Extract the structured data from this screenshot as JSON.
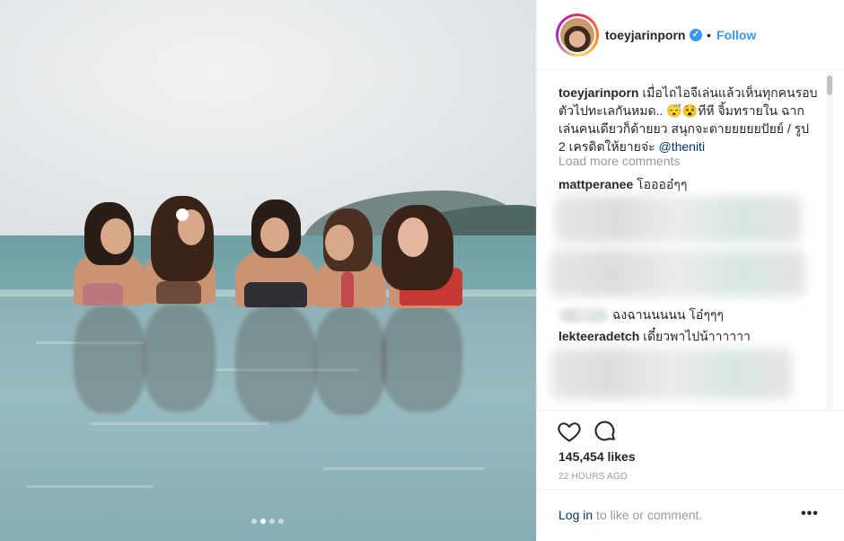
{
  "post": {
    "image": {
      "carousel_dots": 4,
      "active_dot": 2
    },
    "author": {
      "username": "toeyjarinporn",
      "verified_icon": "verified-badge-icon",
      "separator": "•",
      "follow_label": "Follow"
    },
    "caption": {
      "username": "toeyjarinporn",
      "text": "เมื่อไถไอจีเล่นแล้วเห็นทุกคนรอบตัวไปทะเลกันหมด.. 😴😵ทีหี จิ้มทรายใน ฉากเล่นคนเดียวก็ด้ายยว สนุกจะตายยยยยปัยย์ / รูป 2 เครดิตให้ยายจ่ะ ",
      "mention": "@theniti"
    },
    "load_more_label": "Load more comments",
    "comments": [
      {
        "username": "mattperanee",
        "text": "โออออ๋ๆๆ"
      },
      {
        "username": "",
        "text": "ฉงฉานนนนน โอ๋ๆๆๆ"
      },
      {
        "username": "lekteeradetch",
        "text": "เดี๋ยวพาไปน้าาาาาา"
      }
    ],
    "likes": "145,454 likes",
    "timestamp": "22 HOURS AGO",
    "login_link": "Log in",
    "login_suffix": " to like or comment.",
    "more_label": "•••",
    "colors": {
      "accent": "#3897f0",
      "link": "#003569",
      "muted": "#999999"
    }
  }
}
